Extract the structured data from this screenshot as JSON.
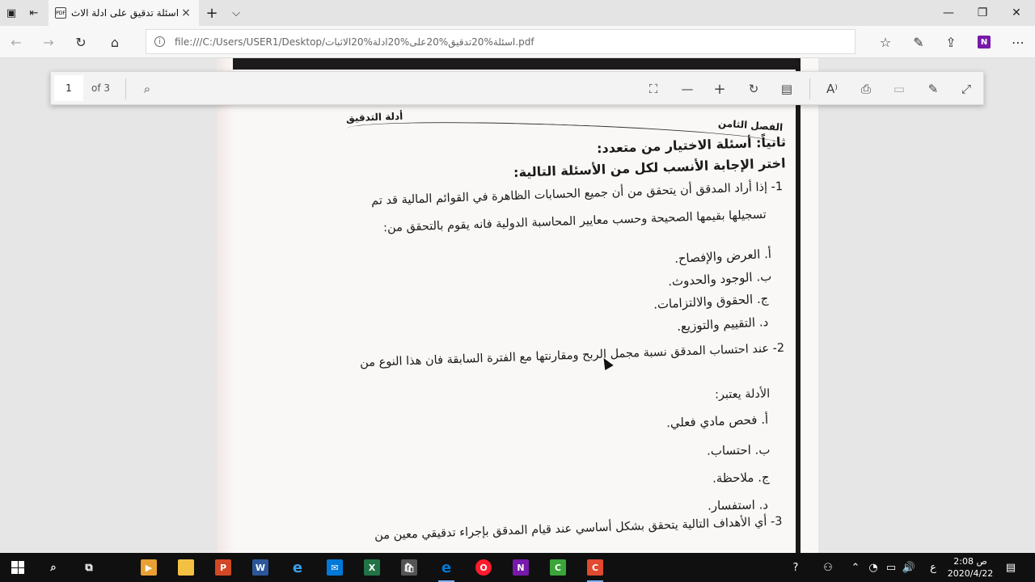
{
  "browser": {
    "tab_title": "اسئلة تدقيق على ادلة الاث",
    "pdf_badge": "PDF",
    "url": "file:///C:/Users/USER1/Desktop/اسئلة%20تدقيق%20على%20ادلة%20الاثبات.pdf",
    "new_tab": "+",
    "tab_close": "×"
  },
  "pdf_toolbar": {
    "page_number": "1",
    "page_total": "of 3"
  },
  "document": {
    "chapter": "الفصل الثامن",
    "header_right": "أدلة التدقيق",
    "section_title": "ثانياً: أسئلة الاختيار من متعدد:",
    "instruction": "اختر الإجابة الأنسب لكل من الأسئلة التالية:",
    "q1_line1": "1- إذا أراد المدقق أن يتحقق من أن جميع الحسابات الظاهرة في القوائم المالية قد تم",
    "q1_line2": "تسجيلها بقيمها الصحيحة وحسب معايير المحاسبة الدولية فانه يقوم بالتحقق من:",
    "q1_options": [
      "أ. العرض والإفصاح.",
      "ب. الوجود والحدوث.",
      "ج. الحقوق والالتزامات.",
      "د. التقييم والتوزيع."
    ],
    "q2_line1": "2- عند احتساب المدقق نسبة مجمل الربح ومقارنتها مع الفترة السابقة فان هذا النوع من",
    "q2_line2": "الأدلة يعتبر:",
    "q2_options": [
      "أ. فحص مادي فعلي.",
      "ب. احتساب.",
      "ج. ملاحظة.",
      "د. استفسار."
    ],
    "q3_line1": "3- أي الأهداف التالية يتحقق بشكل أساسي عند قيام المدقق بإجراء تدقيقي معين من"
  },
  "taskbar": {
    "time": "2:08 ص",
    "date": "2020/4/22",
    "lang": "ع"
  },
  "colors": {
    "onenote": "#7719aa",
    "word": "#2b579a",
    "excel": "#217346",
    "powerpoint": "#d24726",
    "camtasia": "#e04a2f",
    "opera": "#ff1b2d",
    "edge": "#0078d7"
  }
}
